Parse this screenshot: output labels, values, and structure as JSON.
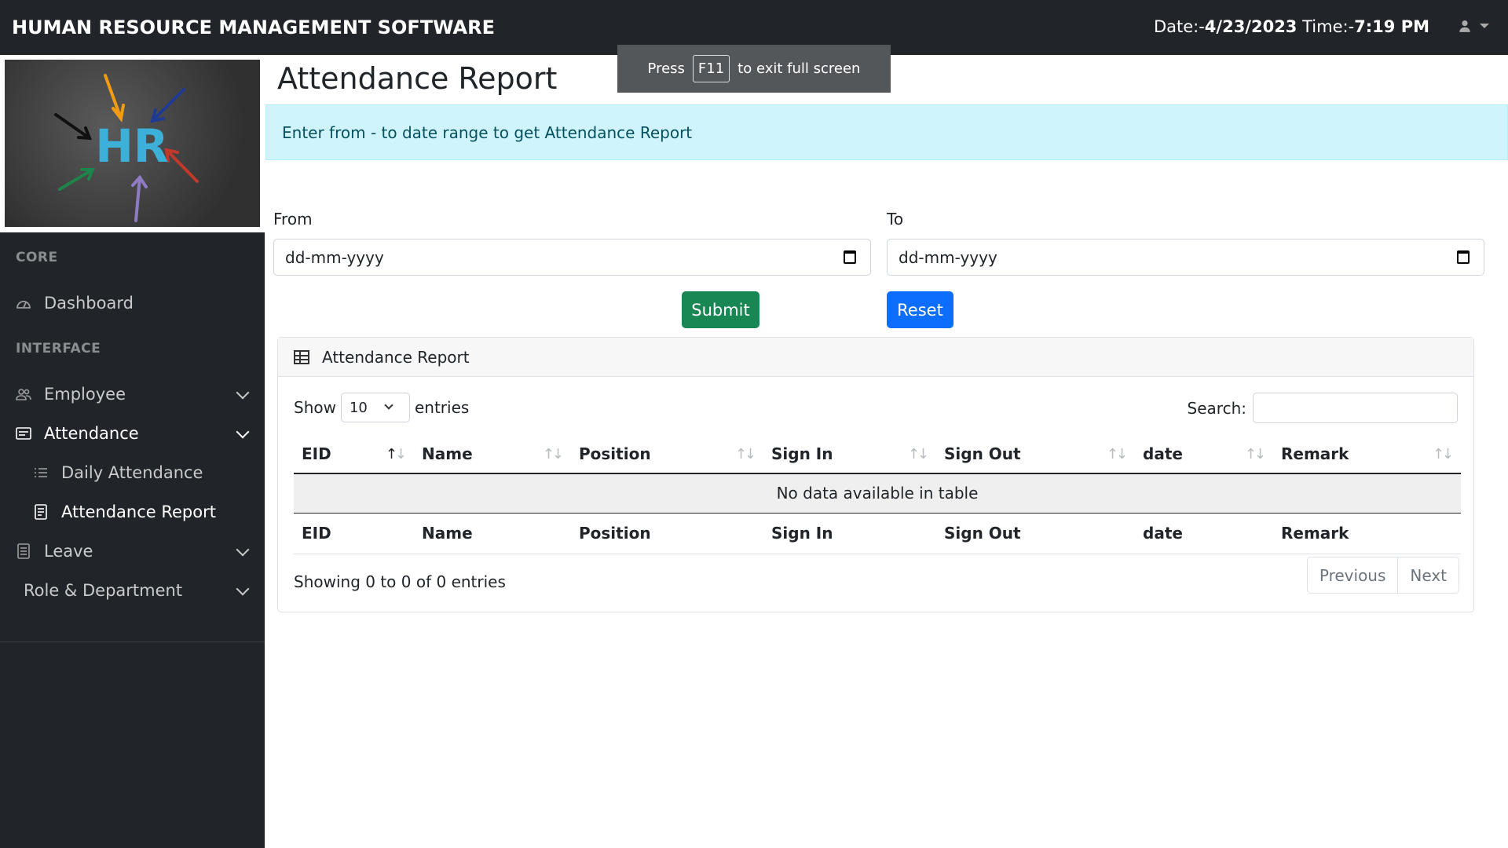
{
  "header": {
    "brand": "HUMAN RESOURCE MANAGEMENT SOFTWARE",
    "date_label": "Date:-",
    "date_value": "4/23/2023",
    "time_label": " Time:-",
    "time_value": "7:19 PM",
    "user_icon": "person-icon"
  },
  "fullscreen_notice": {
    "press": "Press",
    "key": "F11",
    "text": "to exit full screen"
  },
  "sidebar": {
    "logo_text": "HR",
    "core_heading": "CORE",
    "interface_heading": "INTERFACE",
    "items": [
      {
        "label": "Dashboard",
        "icon": "dashboard-icon"
      },
      {
        "label": "Employee",
        "icon": "people-icon"
      },
      {
        "label": "Attendance",
        "icon": "calendar-list-icon"
      },
      {
        "label": "Daily Attendance",
        "icon": "list-icon"
      },
      {
        "label": "Attendance Report",
        "icon": "report-icon"
      },
      {
        "label": "Leave",
        "icon": "leave-icon"
      },
      {
        "label": "Role & Department",
        "icon": ""
      }
    ]
  },
  "main": {
    "title": "Attendance Report",
    "alert": "Enter from - to date range to get Attendance Report",
    "from_label": "From",
    "to_label": "To",
    "from_placeholder": "dd-mm-yyyy",
    "to_placeholder": "dd-mm-yyyy",
    "submit_label": "Submit",
    "reset_label": "Reset",
    "colors": {
      "submit": "#198754",
      "reset": "#0d6efd",
      "alert_bg": "#cff4fc"
    }
  },
  "card": {
    "title": "Attendance Report",
    "show_label": "Show",
    "entries_value": "10",
    "entries_label": "entries",
    "search_label": "Search:",
    "columns": [
      "EID",
      "Name",
      "Position",
      "Sign In",
      "Sign Out",
      "date",
      "Remark"
    ],
    "empty_message": "No data available in table",
    "info": "Showing 0 to 0 of 0 entries",
    "prev_label": "Previous",
    "next_label": "Next"
  }
}
